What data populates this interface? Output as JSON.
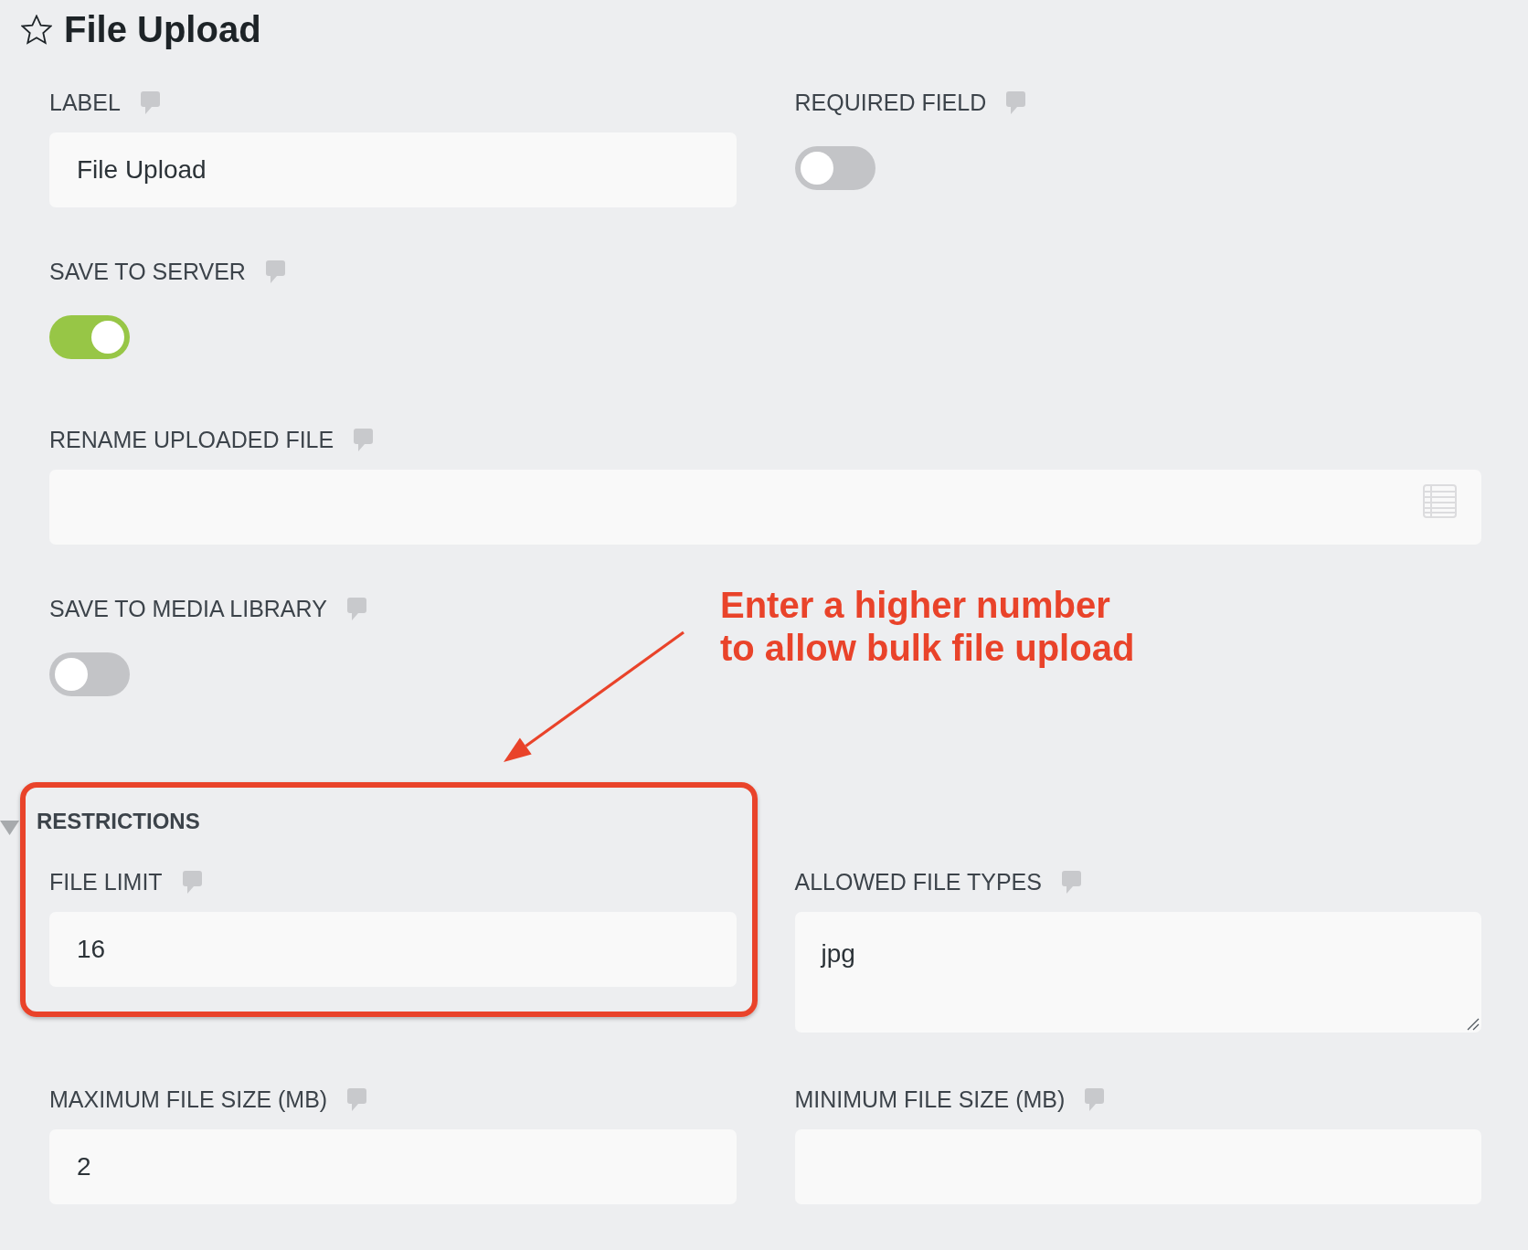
{
  "header": {
    "title": "File Upload"
  },
  "rows": [
    {
      "fields": [
        {
          "kind": "text",
          "label": "LABEL",
          "value": "File Upload"
        },
        {
          "kind": "toggle",
          "label": "REQUIRED FIELD",
          "on": false
        }
      ]
    },
    {
      "fields": [
        {
          "kind": "toggle",
          "label": "SAVE TO SERVER",
          "on": true
        }
      ]
    },
    {
      "fields": [
        {
          "kind": "merge_text",
          "label": "RENAME UPLOADED FILE"
        }
      ]
    },
    {
      "fields": [
        {
          "kind": "toggle",
          "label": "SAVE TO MEDIA LIBRARY",
          "on": false
        }
      ]
    }
  ],
  "restrictions": {
    "heading": "RESTRICTIONS",
    "expanded": true,
    "rows": [
      {
        "fields": [
          {
            "kind": "text",
            "label": "FILE LIMIT",
            "value": "16"
          },
          {
            "kind": "textarea",
            "label": "ALLOWED FILE TYPES",
            "value": "jpg"
          }
        ]
      },
      {
        "fields": [
          {
            "kind": "text",
            "label": "MAXIMUM FILE SIZE (MB)",
            "value": "2"
          },
          {
            "kind": "text",
            "label": "MINIMUM FILE SIZE (MB)"
          }
        ]
      }
    ]
  },
  "annotation": {
    "text": "Enter a higher number to allow bulk file upload"
  }
}
